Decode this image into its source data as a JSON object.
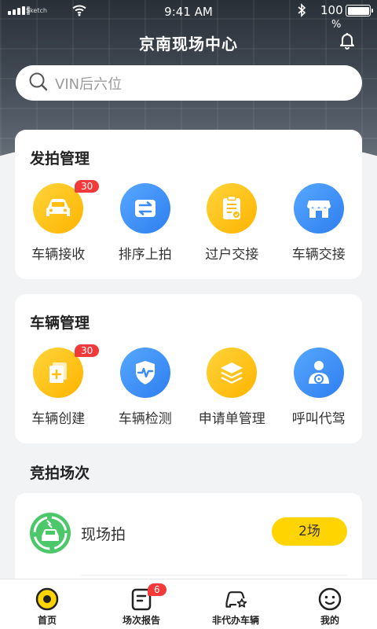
{
  "status_bar": {
    "carrier": "Sketch",
    "time": "9:41 AM",
    "battery_percent": "100",
    "percent_sign": "%"
  },
  "header": {
    "title": "京南现场中心"
  },
  "search": {
    "placeholder": "VIN后六位"
  },
  "auction_management": {
    "title": "发拍管理",
    "items": [
      {
        "label": "车辆接收",
        "badge": "30",
        "icon": "car-icon"
      },
      {
        "label": "排序上拍",
        "badge": "",
        "icon": "swap-icon"
      },
      {
        "label": "过户交接",
        "badge": "",
        "icon": "clipboard-icon"
      },
      {
        "label": "车辆交接",
        "badge": "",
        "icon": "store-icon"
      }
    ]
  },
  "vehicle_management": {
    "title": "车辆管理",
    "items": [
      {
        "label": "车辆创建",
        "badge": "30",
        "icon": "add-document-icon"
      },
      {
        "label": "车辆检测",
        "badge": "",
        "icon": "shield-pulse-icon"
      },
      {
        "label": "申请单管理",
        "badge": "",
        "icon": "layers-icon"
      },
      {
        "label": "呼叫代驾",
        "badge": "",
        "icon": "driver-icon"
      }
    ]
  },
  "auction_sessions": {
    "title": "竞拍场次",
    "items": [
      {
        "name": "现场拍",
        "count": "2场",
        "icon": "live-auction-icon"
      }
    ]
  },
  "tabbar": {
    "items": [
      {
        "label": "首页",
        "badge": "",
        "icon": "home-icon"
      },
      {
        "label": "场次报告",
        "badge": "6",
        "icon": "report-icon"
      },
      {
        "label": "非代办车辆",
        "badge": "",
        "icon": "car-star-icon"
      },
      {
        "label": "我的",
        "badge": "",
        "icon": "profile-icon"
      }
    ]
  },
  "colors": {
    "accent_yellow": "#ffc21a",
    "accent_blue": "#3d8cf5",
    "badge_red": "#f23a3a",
    "count_yellow": "#ffd400",
    "live_green": "#4cc86a"
  }
}
